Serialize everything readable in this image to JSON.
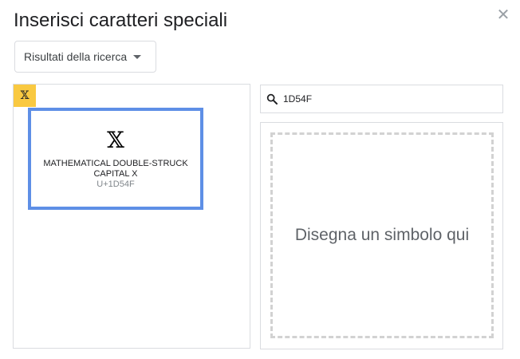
{
  "dialog": {
    "title": "Inserisci caratteri speciali",
    "close_icon": "✕"
  },
  "category_dropdown": {
    "selected": "Risultati della ricerca"
  },
  "results": {
    "items": [
      {
        "glyph": "𝕏",
        "name": "MATHEMATICAL DOUBLE-STRUCK CAPITAL X",
        "code": "U+1D54F"
      }
    ]
  },
  "search": {
    "value": "1D54F",
    "icon": "search-icon"
  },
  "draw": {
    "placeholder": "Disegna un simbolo qui"
  },
  "colors": {
    "highlight_tile": "#f9c941",
    "selected_border": "#5e8fe6"
  }
}
